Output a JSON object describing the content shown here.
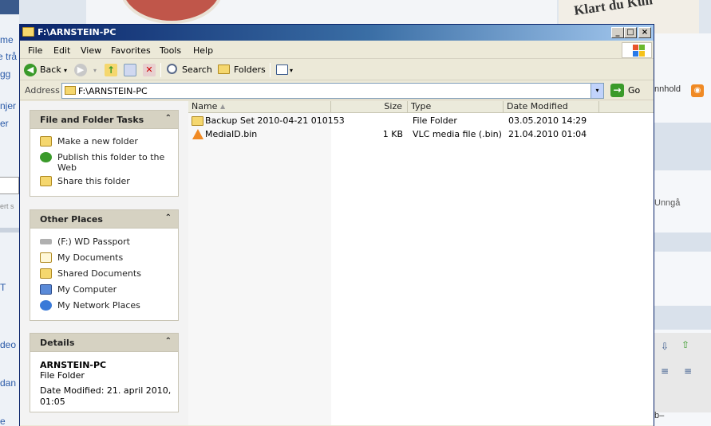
{
  "background": {
    "left_fragments": [
      "me",
      "e trå",
      "gg",
      "njer",
      "er",
      "ert s",
      "T",
      "deo",
      "dan",
      "e"
    ],
    "right_fragments": [
      "nnhold",
      "Unngå",
      "b–"
    ],
    "banner_text": "Klart du Kun",
    "rss_icon": "rss-icon"
  },
  "window": {
    "title": "F:\\ARNSTEIN-PC",
    "controls": {
      "minimize": "_",
      "maximize": "□",
      "close": "×"
    }
  },
  "menu": [
    "File",
    "Edit",
    "View",
    "Favorites",
    "Tools",
    "Help"
  ],
  "toolbar": {
    "back_label": "Back",
    "search_label": "Search",
    "folders_label": "Folders",
    "dropdown_glyph": "▾"
  },
  "address": {
    "label": "Address",
    "value": "F:\\ARNSTEIN-PC",
    "go_label": "Go"
  },
  "tasks": {
    "file_folder": {
      "title": "File and Folder Tasks",
      "items": [
        "Make a new folder",
        "Publish this folder to the",
        "Web",
        "Share this folder"
      ]
    },
    "other_places": {
      "title": "Other Places",
      "items": [
        "(F:) WD Passport",
        "My Documents",
        "Shared Documents",
        "My Computer",
        "My Network Places"
      ]
    },
    "details": {
      "title": "Details",
      "name": "ARNSTEIN-PC",
      "type": "File Folder",
      "modified_line1": "Date Modified: 21. april 2010,",
      "modified_line2": "01:05"
    },
    "collapse_glyph": "⌃"
  },
  "columns": {
    "name": "Name",
    "size": "Size",
    "type": "Type",
    "date": "Date Modified",
    "sort_glyph": "▲"
  },
  "files": [
    {
      "name": "Backup Set 2010-04-21 010153",
      "size": "",
      "type": "File Folder",
      "date": "03.05.2010 14:29",
      "icon": "folder-icon"
    },
    {
      "name": "MediaID.bin",
      "size": "1 KB",
      "type": "VLC media file (.bin)",
      "date": "21.04.2010 01:04",
      "icon": "vlc-icon"
    }
  ],
  "colors": {
    "title_start": "#0a246a",
    "title_end": "#a6caf0",
    "window_bg": "#ece9d8",
    "link_blue": "#2a5aa8"
  }
}
